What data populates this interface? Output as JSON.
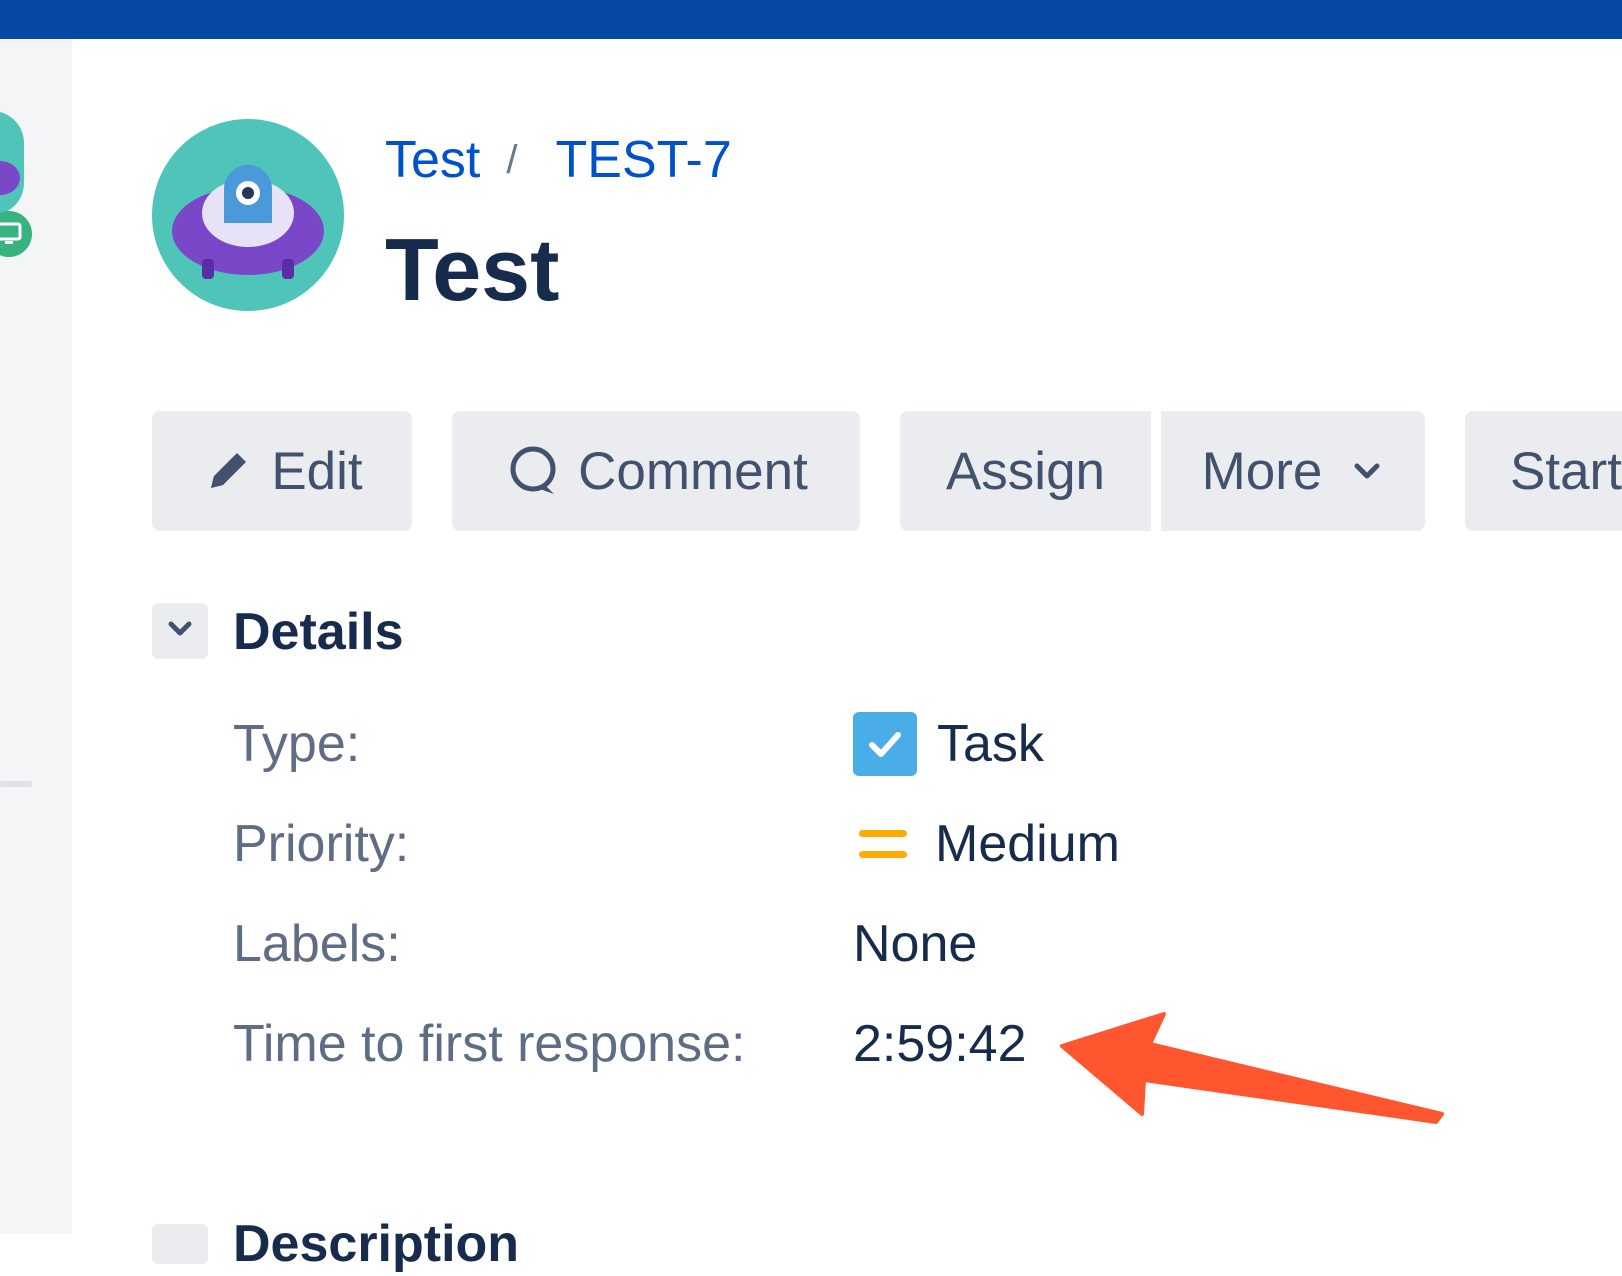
{
  "colors": {
    "topbar": "#0747a6",
    "link": "#0052cc",
    "text_primary": "#172b4d",
    "text_secondary": "#5e6c84",
    "button_bg": "#ebecf0",
    "task_icon": "#4bade8",
    "priority_medium": "#ffab00",
    "annotation_arrow": "#ff5630"
  },
  "breadcrumb": {
    "project": "Test",
    "separator": "/",
    "issue_key": "TEST-7"
  },
  "issue": {
    "title": "Test",
    "avatar_icon": "ufo-avatar-icon"
  },
  "toolbar": {
    "edit_label": "Edit",
    "edit_icon": "pencil-icon",
    "comment_label": "Comment",
    "comment_icon": "speech-bubble-icon",
    "assign_label": "Assign",
    "more_label": "More",
    "more_icon": "chevron-down-icon",
    "start_label": "Start"
  },
  "details": {
    "heading": "Details",
    "fields": [
      {
        "label": "Type:",
        "value": "Task",
        "icon": "task-checkbox-icon"
      },
      {
        "label": "Priority:",
        "value": "Medium",
        "icon": "priority-medium-icon"
      },
      {
        "label": "Labels:",
        "value": "None"
      },
      {
        "label": "Time to first response:",
        "value": "2:59:42"
      }
    ]
  },
  "description": {
    "heading": "Description"
  }
}
